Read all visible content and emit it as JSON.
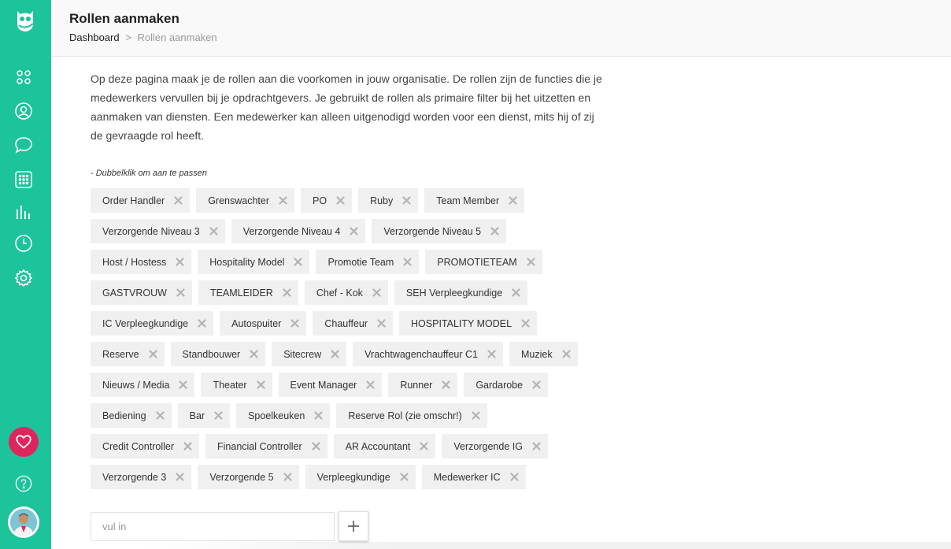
{
  "header": {
    "title": "Rollen aanmaken",
    "breadcrumb": {
      "home": "Dashboard",
      "separator": ">",
      "current": "Rollen aanmaken"
    }
  },
  "intro": "Op deze pagina maak je de rollen aan die voorkomen in jouw organisatie. De rollen zijn de functies die je medewerkers vervullen bij je opdrachtgevers. Je gebruikt de rollen als primaire filter bij het uitzetten en aanmaken van diensten. Een medewerker kan alleen uitgenodigd worden voor een dienst, mits hij of zij de gevraagde rol heeft.",
  "hint": "- Dubbelklik om aan te passen",
  "roles": [
    "Order Handler",
    "Grenswachter",
    "PO",
    "Ruby",
    "Team Member",
    "Verzorgende Niveau 3",
    "Verzorgende Niveau 4",
    "Verzorgende Niveau 5",
    "Host / Hostess",
    "Hospitality Model",
    "Promotie Team",
    "PROMOTIETEAM",
    "GASTVROUW",
    "TEAMLEIDER",
    "Chef - Kok",
    "SEH Verpleegkundige",
    "IC Verpleegkundige",
    "Autospuiter",
    "Chauffeur",
    "HOSPITALITY MODEL",
    "Reserve",
    "Standbouwer",
    "Sitecrew",
    "Vrachtwagenchauffeur C1",
    "Muziek",
    "Nieuws / Media",
    "Theater",
    "Event Manager",
    "Runner",
    "Gardarobe",
    "Bediening",
    "Bar",
    "Spoelkeuken",
    "Reserve Rol (zie omschr!)",
    "Credit Controller",
    "Financial Controller",
    "AR Accountant",
    "Verzorgende IG",
    "Verzorgende 3",
    "Verzorgende 5",
    "Verpleegkundige",
    "Medewerker IC"
  ],
  "add_form": {
    "placeholder": "vul in",
    "button_icon": "plus-icon"
  },
  "sidebar": {
    "icons": [
      "owl-logo-icon",
      "dashboard-grid-icon",
      "user-icon",
      "chat-icon",
      "calendar-icon",
      "stats-icon",
      "clock-icon",
      "gear-icon",
      "heart-icon",
      "help-icon",
      "avatar"
    ]
  },
  "colors": {
    "sidebar": "#1dc39b",
    "heart": "#e0245e",
    "tag_bg": "#f0f0f0",
    "header_bg": "#f9f9f9"
  }
}
